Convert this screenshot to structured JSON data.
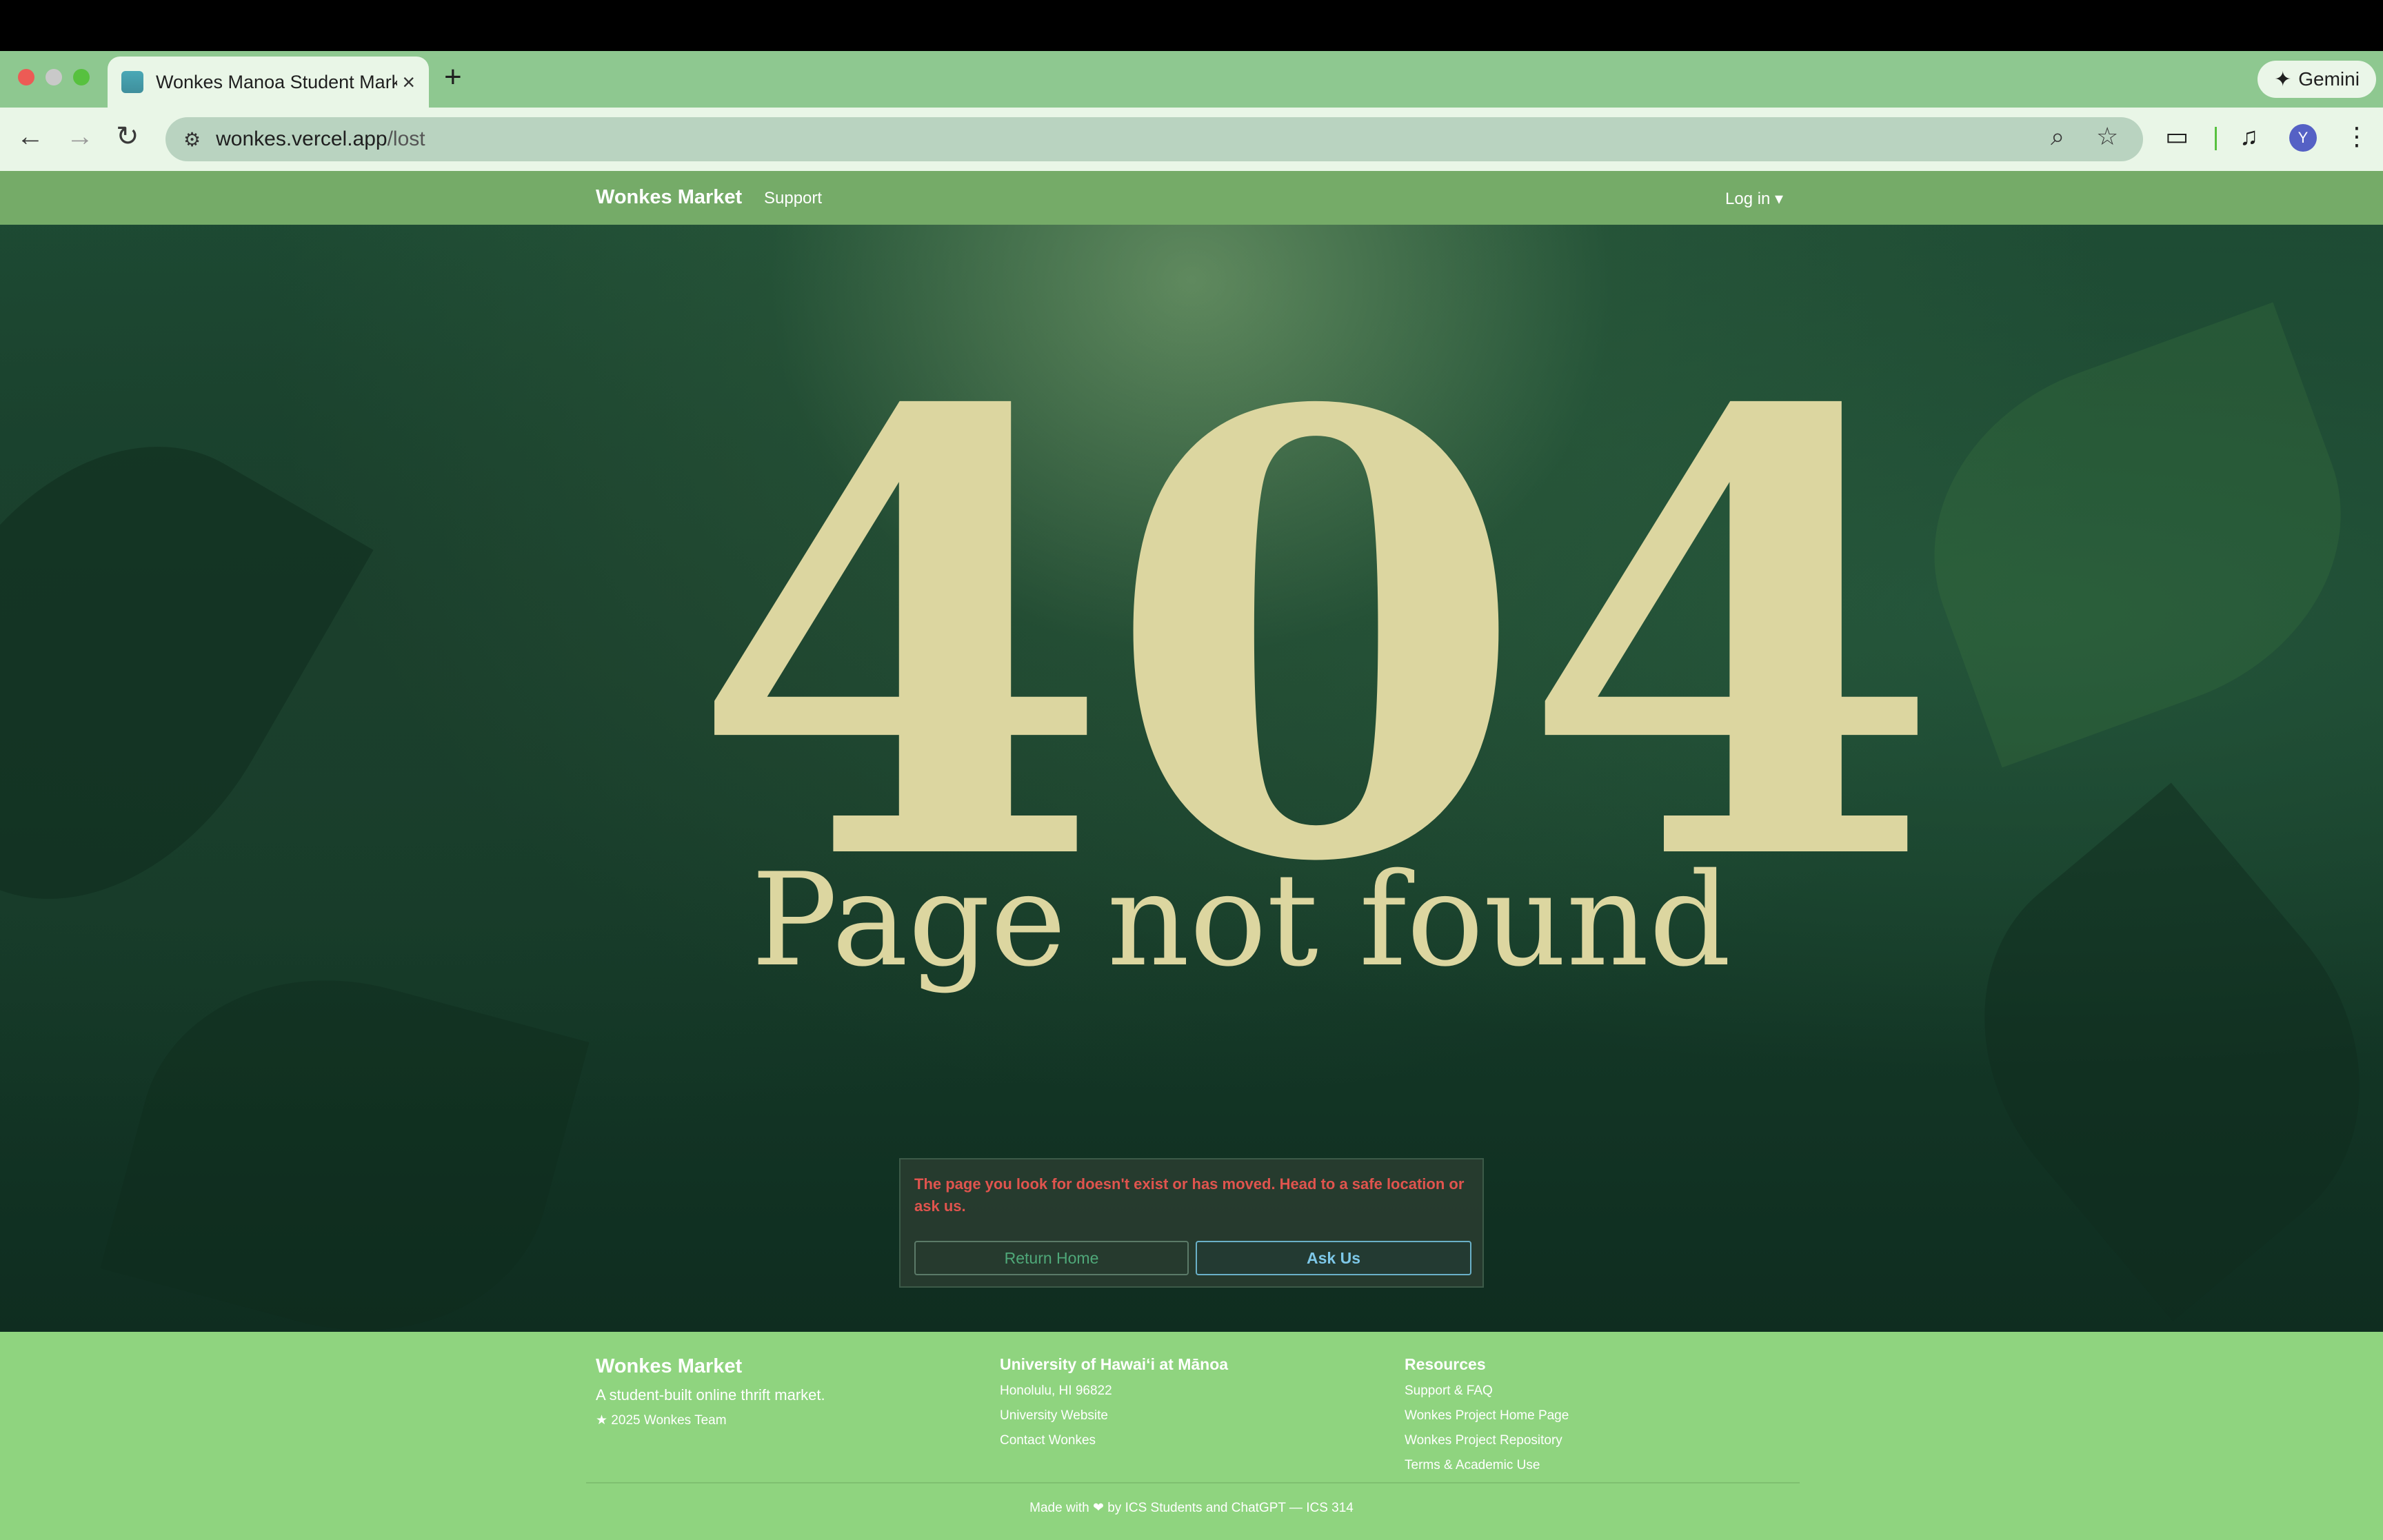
{
  "browser": {
    "tab_title": "Wonkes Manoa Student Mark",
    "tab_close": "×",
    "new_tab": "+",
    "url_host": "wonkes.vercel.app",
    "url_path": "/lost",
    "gemini_label": "Gemini",
    "avatar_letter": "Y",
    "icons": {
      "back": "←",
      "forward": "→",
      "reload": "↻",
      "site": "⚙",
      "zoom": "⌕",
      "star": "☆",
      "media": "▭",
      "playlist": "♫",
      "menu": "⋮",
      "spark": "✦"
    }
  },
  "navbar": {
    "brand": "Wonkes Market",
    "support": "Support",
    "login": "Log in ▾"
  },
  "hero": {
    "code": "404",
    "headline": "Page not found",
    "message": "The page you look for doesn't exist or has moved. Head to a safe location or ask us.",
    "return_home": "Return Home",
    "ask_us": "Ask Us"
  },
  "footer": {
    "brand": "Wonkes Market",
    "tagline": "A student-built online thrift market.",
    "copyright": "★ 2025 Wonkes Team",
    "university": {
      "heading": "University of Hawaiʻi at Mānoa",
      "lines": [
        "Honolulu, HI 96822",
        "University Website",
        "Contact Wonkes"
      ]
    },
    "resources": {
      "heading": "Resources",
      "links": [
        "Support & FAQ",
        "Wonkes Project Home Page",
        "Wonkes Project Repository",
        "Terms & Academic Use"
      ]
    },
    "bottom": "Made with ❤ by ICS Students and ChatGPT — ICS 314"
  },
  "colors": {
    "tabstrip": "#8ec890",
    "navbar": "#75ab68",
    "footer": "#8fd47f",
    "error_text": "#e0544e",
    "headline": "#dcd6a0"
  }
}
